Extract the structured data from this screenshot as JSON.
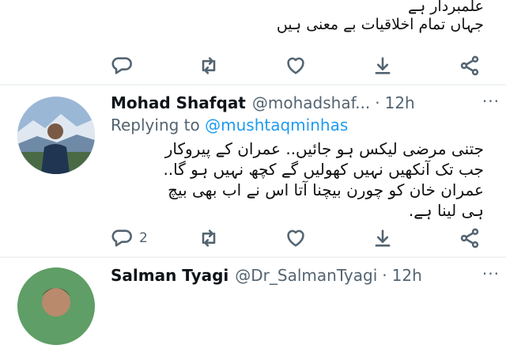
{
  "tweets": [
    {
      "text_lines": [
        "علمبردار ہے",
        "جہاں تمام اخلاقیات بے معنی ہیں"
      ],
      "actions": {
        "reply_count": "",
        "retweet_count": "",
        "like_count": ""
      }
    },
    {
      "author_name": "Mohad Shafqat",
      "handle": "@mohadshaf...",
      "separator": "·",
      "time": "12h",
      "replying_prefix": "Replying to",
      "replying_to": "@mushtaqminhas",
      "text_lines": [
        "جتنی مرضی لیکس ہو جائیں.. عمران کے پیروکار",
        "جب تک آنکھیں نہیں کھولیں گے کچھ نہیں ہو گا..",
        "عمران خان کو چورن بیچنا آتا اس نے اب بھی بیچ",
        "ہی لینا ہے."
      ],
      "actions": {
        "reply_count": "2",
        "retweet_count": "",
        "like_count": ""
      }
    },
    {
      "author_name": "Salman Tyagi",
      "handle": "@Dr_SalmanTyagi",
      "separator": "·",
      "time": "12h"
    }
  ],
  "icons": [
    "reply-icon",
    "retweet-icon",
    "like-icon",
    "download-icon",
    "share-icon",
    "more-icon"
  ],
  "colors": {
    "accent": "#1d9bf0",
    "muted": "#536471",
    "divider": "#eff3f4",
    "text": "#0f1419"
  }
}
